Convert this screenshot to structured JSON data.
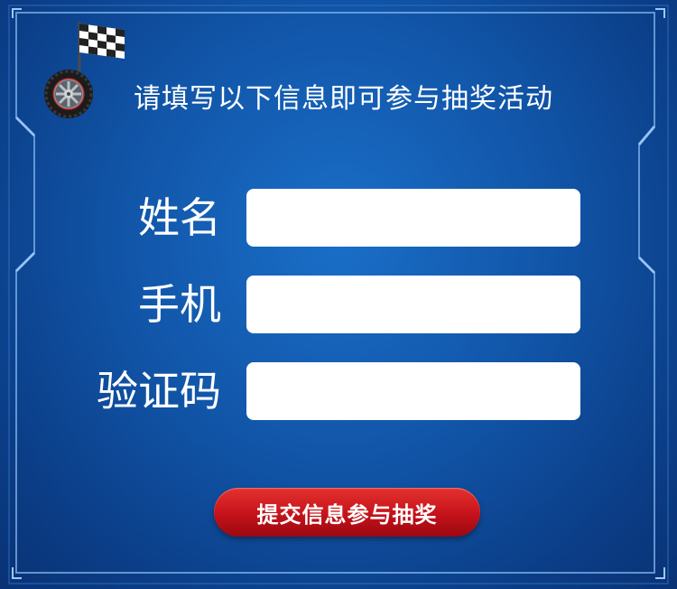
{
  "header": {
    "title": "请填写以下信息即可参与抽奖活动",
    "logo_icon": "checkered-flag-tire-icon"
  },
  "form": {
    "fields": [
      {
        "label": "姓名",
        "value": "",
        "placeholder": ""
      },
      {
        "label": "手机",
        "value": "",
        "placeholder": ""
      },
      {
        "label": "验证码",
        "value": "",
        "placeholder": ""
      }
    ],
    "submit_label": "提交信息参与抽奖"
  },
  "colors": {
    "background": "#1155a8",
    "frame": "#6fa8e6",
    "button": "#c4121a",
    "text": "#ffffff",
    "input": "#ffffff"
  }
}
